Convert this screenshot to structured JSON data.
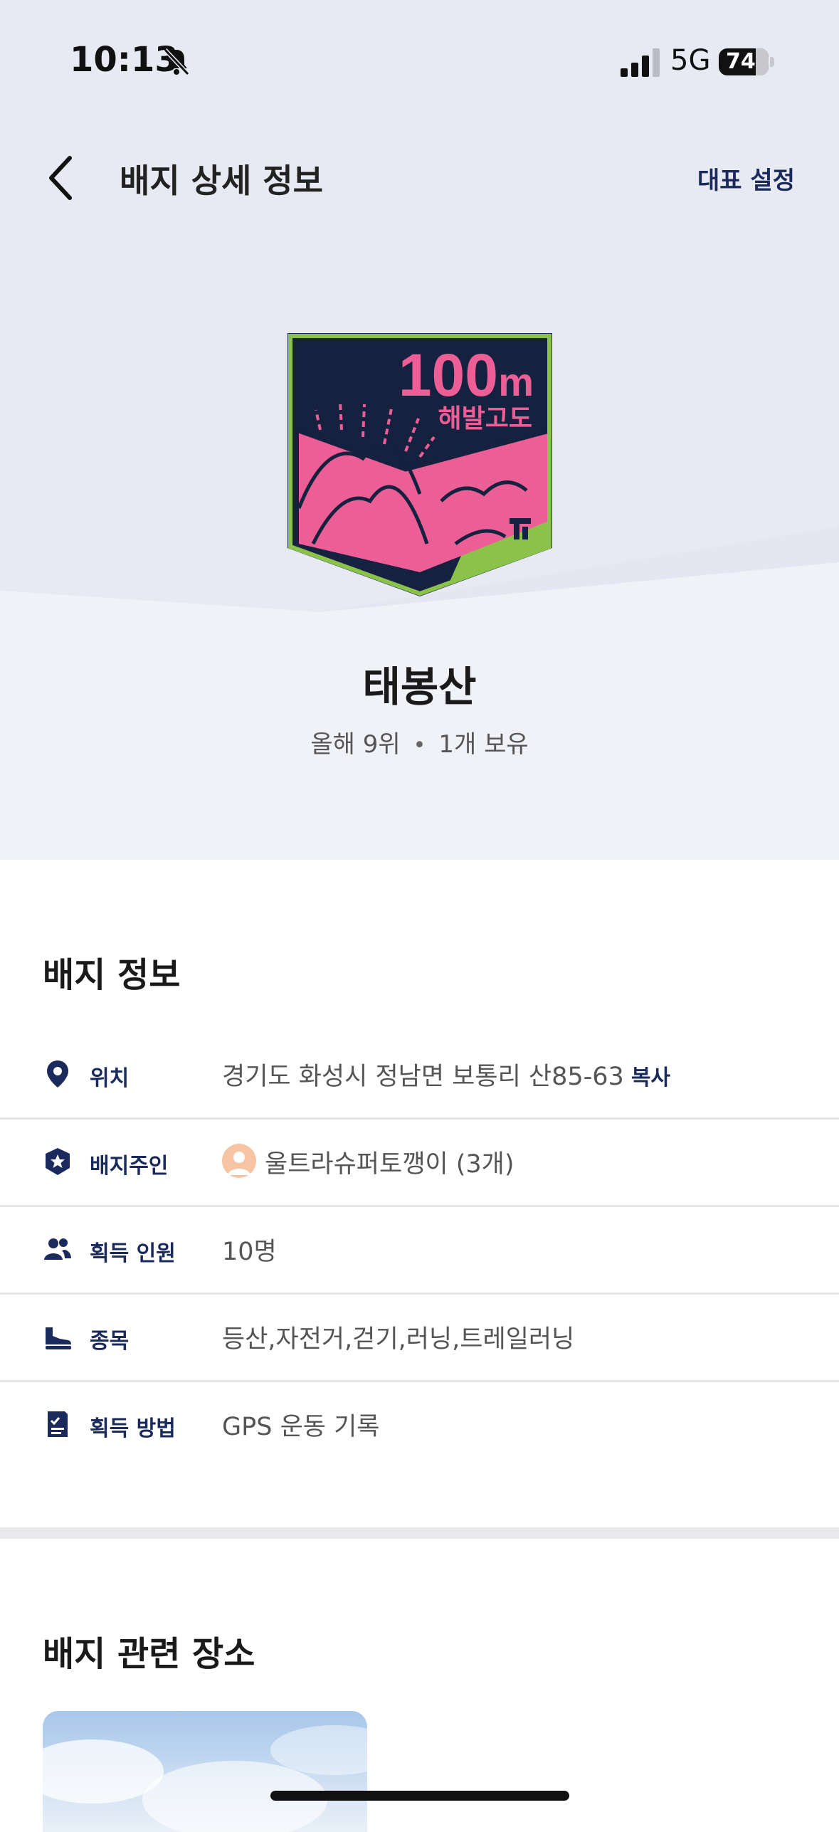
{
  "status_bar": {
    "time": "10:13",
    "network": "5G",
    "battery": "74"
  },
  "nav": {
    "title": "배지 상세 정보",
    "representative_button": "대표 설정"
  },
  "badge": {
    "art_altitude": "100",
    "art_unit": "m",
    "art_caption": "해발고도",
    "art_brand": "Tr",
    "name": "태봉산",
    "rank": "올해 9위",
    "separator": "•",
    "owned": "1개 보유"
  },
  "info": {
    "title": "배지 정보",
    "rows": [
      {
        "icon": "location-pin-icon",
        "label": "위치",
        "value": "경기도 화성시 정남면 보통리 산85-63",
        "action": "복사"
      },
      {
        "icon": "star-shield-icon",
        "label": "배지주인",
        "value": "울트라슈퍼토깽이 (3개)"
      },
      {
        "icon": "people-icon",
        "label": "획득 인원",
        "value": "10명"
      },
      {
        "icon": "shoe-icon",
        "label": "종목",
        "value": "등산,자전거,걷기,러닝,트레일러닝"
      },
      {
        "icon": "checklist-icon",
        "label": "획득 방법",
        "value": "GPS 운동 기록"
      }
    ]
  },
  "places": {
    "title": "배지 관련 장소"
  },
  "colors": {
    "navy": "#1b2a5c",
    "badge_pink": "#ec5f96",
    "badge_green": "#8bc34a",
    "hero_bg": "#e8eaf3"
  }
}
